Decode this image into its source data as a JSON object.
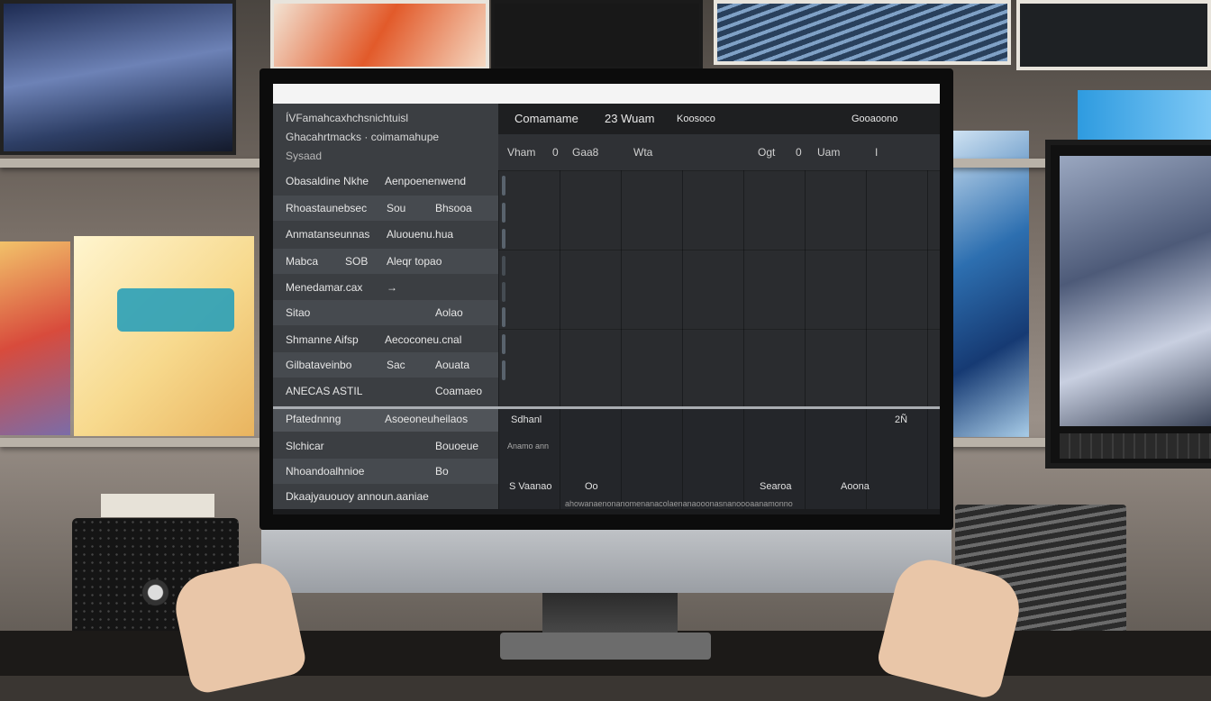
{
  "background": {
    "speaker_label": ""
  },
  "screen": {
    "sidebar_header": [
      "ÍVFamahcaxhchsnichtuisl",
      "Ghacahrtmacks  · coimamahupe",
      "Sysaad"
    ],
    "sidebar_rows": [
      {
        "c1": "Obasaldine  Nkhe",
        "c2": "",
        "c3": "Aenpoenenwend"
      },
      {
        "c1": "Rhoastaunebsec",
        "c2": "Sou",
        "c3": "Bhsooa"
      },
      {
        "c1": "Anmatanseunnas",
        "c2": "",
        "c3": "Aluouenu.hua"
      },
      {
        "c1": "Mabca",
        "c2": "SOB",
        "c3": "Aleqr topao"
      },
      {
        "c1": "Menedamar.cax",
        "c2": "",
        "c3": "→"
      },
      {
        "c1": "Sitao",
        "c2": "",
        "c3": "Aolao"
      },
      {
        "c1": "Shmanne Aifsp",
        "c2": "",
        "c3": "Aecoconeu.cnal"
      },
      {
        "c1": "Gilbataveinbo",
        "c2": "Sac",
        "c3": "Aouata"
      },
      {
        "c1": "ANECAS ASTIL",
        "c2": "",
        "c3": "Coamaeo"
      },
      {
        "c1": "Pfatednnng",
        "c2": "",
        "c3": "Asoeoneuheilaos"
      },
      {
        "c1": "Slchicar",
        "c2": "",
        "c3": "Bouoeue"
      },
      {
        "c1": "Nhoandoalhnioe",
        "c2": "",
        "c3": "Bo"
      },
      {
        "c1": "Dkaajyauouoy announ.aaniae",
        "c2": "",
        "c3": ""
      }
    ],
    "main_header": {
      "title": "Comamame",
      "sub": "23 Wuam",
      "mid": "Koosoco",
      "right": "Gooaoono"
    },
    "columns": [
      "Vham",
      "0",
      "Gaa8",
      "Wta",
      "Ogt",
      "0",
      "Uam",
      "I"
    ],
    "lower": {
      "left_label": "Sdhanl",
      "right_value": "2Ñ",
      "row2": "Anamo ann",
      "foot_left": "S Vaanao",
      "foot_mid": "Oo",
      "foot_right": "Searoa",
      "foot_end": "Aoona",
      "ticker": "ahowanaenonanomenanacolaenanaooonasnanoooaanamonno"
    }
  },
  "colors": {
    "screen_bg": "#26282b",
    "sidebar_bg": "#3b3e42",
    "header_bg": "#1e1f21",
    "divider": "#a9adb2"
  }
}
